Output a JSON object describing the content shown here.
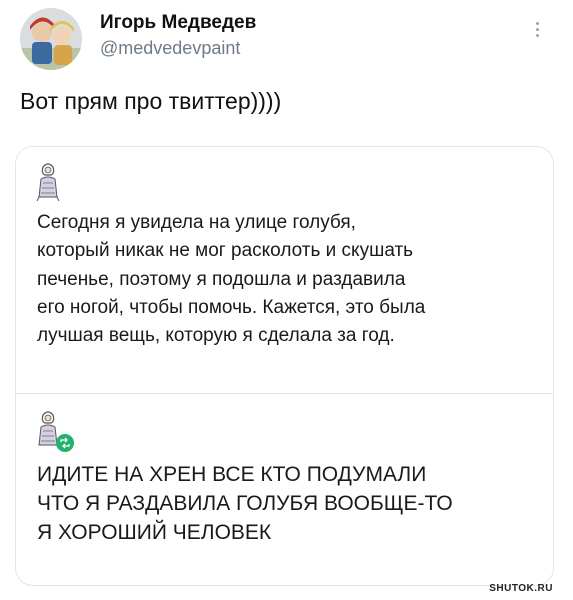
{
  "author": {
    "name": "Игорь Медведев",
    "handle": "@medvedevpaint"
  },
  "tweet": {
    "text": "Вот прям про твиттер))))"
  },
  "quoted_posts": [
    {
      "lines": [
        "Сегодня я увидела на улице голубя,",
        "который никак не мог расколоть и скушать",
        "печенье, поэтому я подошла и раздавила",
        "его ногой, чтобы помочь. Кажется, это была",
        "лучшая вещь, которую я сделала за год."
      ]
    },
    {
      "lines": [
        "ИДИТЕ НА ХРЕН ВСЕ КТО ПОДУМАЛИ",
        "ЧТО Я РАЗДАВИЛА ГОЛУБЯ ВООБЩЕ-ТО",
        "Я ХОРОШИЙ ЧЕЛОВЕК"
      ]
    }
  ],
  "watermark": "SHUTOK.RU",
  "colors": {
    "handle": "#6e7a85",
    "border": "#e3e6e9",
    "retweet_badge": "#22b26b"
  },
  "icons": {
    "more": "more-vertical-icon",
    "retweet": "retweet-icon"
  }
}
